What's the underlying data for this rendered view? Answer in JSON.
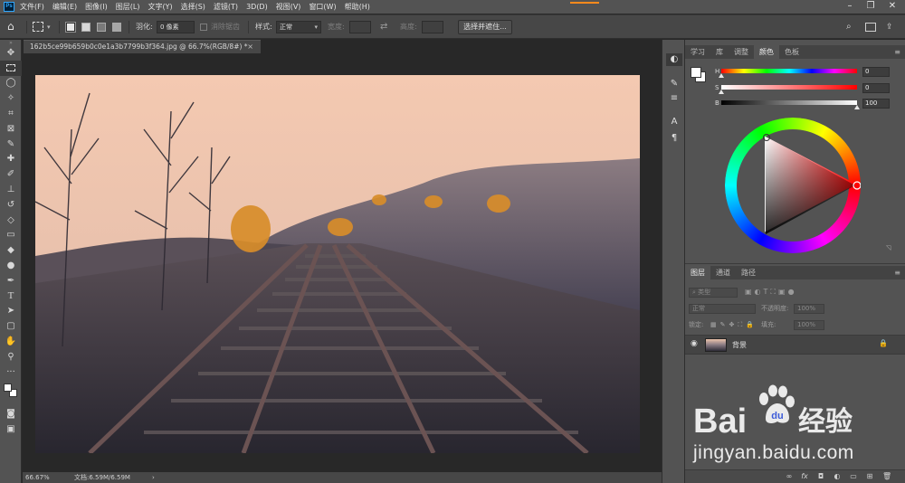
{
  "menubar": {
    "logo": "Ps",
    "items": [
      "文件(F)",
      "编辑(E)",
      "图像(I)",
      "图层(L)",
      "文字(Y)",
      "选择(S)",
      "滤镜(T)",
      "3D(D)",
      "视图(V)",
      "窗口(W)",
      "帮助(H)"
    ]
  },
  "options": {
    "feather_label": "羽化:",
    "feather_value": "0 像素",
    "antialias_label": "消除锯齿",
    "style_label": "样式:",
    "style_value": "正常",
    "width_label": "宽度:",
    "height_label": "高度:",
    "select_mask_label": "选择并遮住..."
  },
  "document": {
    "tab_title": "162b5ce99b659b0c0e1a3b7799b3f364.jpg @ 66.7%(RGB/8#) *",
    "close_glyph": "×",
    "zoom": "66.67%",
    "doc_size": "文档:6.59M/6.59M",
    "status_arrow": "›"
  },
  "color_panel": {
    "tabs": [
      "学习",
      "库",
      "调整",
      "颜色",
      "色板"
    ],
    "active_tab": "颜色",
    "h_label": "H",
    "h_value": "0",
    "s_label": "S",
    "s_value": "0",
    "b_label": "B",
    "b_value": "100",
    "h_thumb": 0.0,
    "s_thumb": 0.0,
    "b_thumb": 1.0,
    "hue_color": "#ff0000"
  },
  "layers_panel": {
    "tabs": [
      "图层",
      "通道",
      "路径"
    ],
    "active_tab": "图层",
    "filter_kind": "类型",
    "blend_mode": "正常",
    "opacity_label": "不透明度:",
    "opacity_value": "100%",
    "lock_label": "锁定:",
    "fill_label": "填充:",
    "fill_value": "100%",
    "layers": [
      {
        "name": "背景",
        "visible": true,
        "locked": true
      }
    ]
  },
  "watermark": {
    "brand_left": "Bai",
    "brand_right": "经验",
    "url": "jingyan.baidu.com"
  },
  "colors": {
    "accent": "#ff8a1c",
    "ps_blue": "#31a8ff"
  }
}
